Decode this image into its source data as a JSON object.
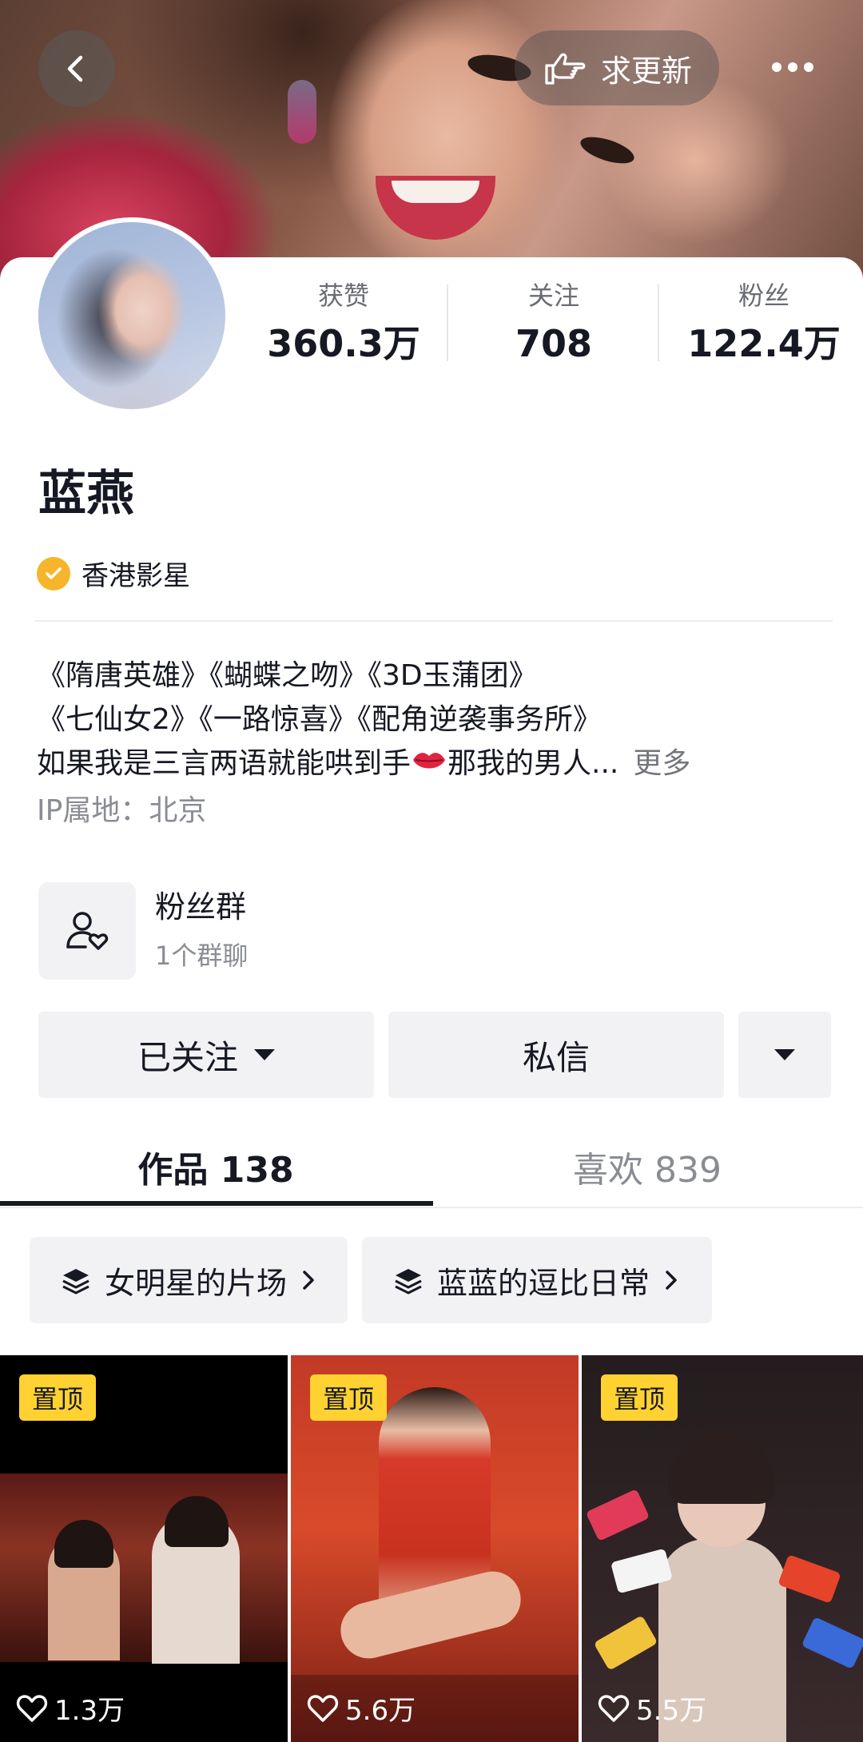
{
  "header": {
    "update_label": "求更新",
    "back_icon": "chevron-left-icon",
    "update_icon": "pointing-hand-icon",
    "more_icon": "more-horizontal-icon"
  },
  "stats": [
    {
      "label": "获赞",
      "value": "360.3万"
    },
    {
      "label": "关注",
      "value": "708"
    },
    {
      "label": "粉丝",
      "value": "122.4万"
    }
  ],
  "profile": {
    "name": "蓝燕",
    "verified_label": "香港影星",
    "bio_line1": "《隋唐英雄》《蝴蝶之吻》《3D玉蒲团》",
    "bio_line2": "《七仙女2》《一路惊喜》《配角逆袭事务所》",
    "bio_line3_a": "如果我是三言两语就能哄到手",
    "bio_line3_b": "那我的男人...",
    "bio_more": "更多",
    "ip_location": "IP属地：北京"
  },
  "fan_group": {
    "title": "粉丝群",
    "subtitle": "1个群聊",
    "icon": "fan-group-icon"
  },
  "actions": {
    "follow_label": "已关注",
    "message_label": "私信"
  },
  "tabs": [
    {
      "label": "作品 138",
      "active": true
    },
    {
      "label": "喜欢 839",
      "active": false
    }
  ],
  "collections": [
    {
      "label": "女明星的片场"
    },
    {
      "label": "蓝蓝的逗比日常"
    }
  ],
  "videos": [
    {
      "pinned_label": "置顶",
      "likes": "1.3万"
    },
    {
      "pinned_label": "置顶",
      "likes": "5.6万"
    },
    {
      "pinned_label": "置顶",
      "likes": "5.5万"
    }
  ],
  "colors": {
    "accent_yellow": "#ffd231",
    "verify_badge": "#f7b52c",
    "text_primary": "#161823",
    "text_secondary": "#8a8c93",
    "button_bg": "#f2f2f4"
  }
}
